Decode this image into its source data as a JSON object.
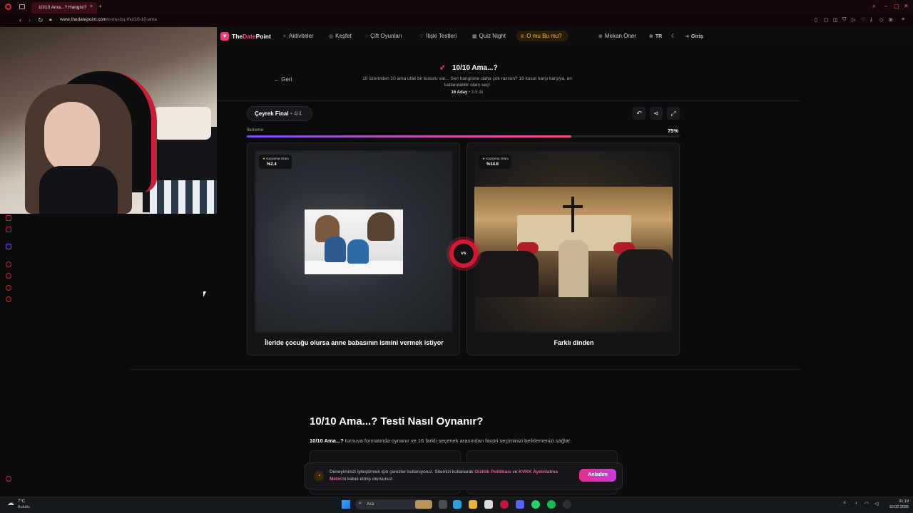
{
  "browser": {
    "tab_title": "10/10 Ama...? Hangisi?",
    "tab_close": "×",
    "new_tab": "+",
    "url_domain": "www.thedatepoint.com",
    "url_path": "/o-mu-bu-mu/10-10-ama"
  },
  "site": {
    "logo_main": "The",
    "logo_accent": "Date",
    "logo_end": "Point",
    "nav": [
      {
        "label": "Aktiviteler",
        "icon": "sparkle-icon"
      },
      {
        "label": "Keşfet",
        "icon": "compass-icon"
      },
      {
        "label": "Çift Oyunları",
        "icon": "chat-icon"
      },
      {
        "label": "İlişki Testleri",
        "icon": "heart-icon"
      },
      {
        "label": "Quiz Night",
        "icon": "grid-icon"
      },
      {
        "label": "O mu Bu mu?",
        "icon": "trophy-icon"
      }
    ],
    "right_nav": {
      "suggest": "Mekan Öner",
      "language": "TR",
      "login": "Giriş"
    }
  },
  "test": {
    "back": "Geri",
    "title": "10/10 Ama...?",
    "description": "10 üzerinden 10 ama ufak bir kusuru var... Sen hangisine daha çok razısın? 16 kusur karşı karşıya, en katlanılabilir olanı seç!",
    "candidates": "16 Aday",
    "duration": "3-5 dk"
  },
  "round": {
    "label": "Çeyrek Final",
    "separator": "•",
    "count": "4/4"
  },
  "progress": {
    "label": "İlerleme",
    "value_text": "75%",
    "fraction": 0.75
  },
  "cards": [
    {
      "badge_label": "Kazanma Oranı",
      "badge_value": "%2.4",
      "caption": "İleride çocuğu olursa anne babasının ismini vermek istiyor"
    },
    {
      "badge_label": "Kazanma Oranı",
      "badge_value": "%14.6",
      "caption": "Farklı dinden"
    }
  ],
  "vs": "vs",
  "howto": {
    "title": "10/10 Ama...? Testi Nasıl Oynanır?",
    "desc_bold": "10/10 Ama...?",
    "desc_rest": " turnuva formatında oynanır ve 16 farklı seçenek arasından favori seçiminizi belirlemenizi sağlar."
  },
  "cookie": {
    "text_1": "Deneyiminizi iyileştirmek için çerezler kullanıyoruz. Sitemizi kullanarak ",
    "link_1": "Gizlilik Politikası",
    "text_2": " ve ",
    "link_2": "KVKK Aydınlatma Metni",
    "text_3": "'ni kabul etmiş olursunuz.",
    "button": "Anladım"
  },
  "taskbar": {
    "temp": "7°C",
    "condition": "Bulutlu",
    "search_placeholder": "Ara",
    "time": "01:19",
    "date": "10.02.2026"
  },
  "colors": {
    "accent_pink": "#f04e86",
    "accent_gold": "#f2c04c",
    "vs_red": "#d01a35"
  }
}
